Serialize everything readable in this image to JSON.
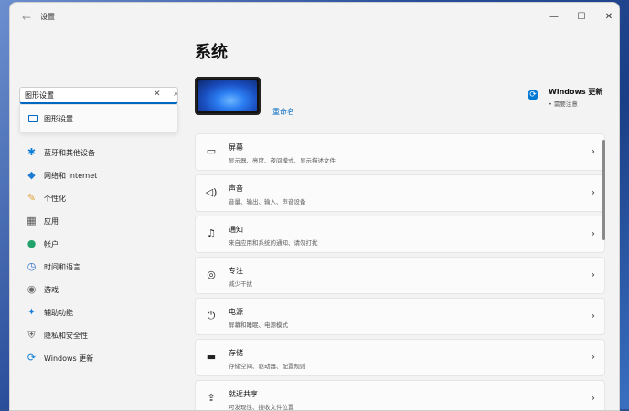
{
  "window": {
    "title": "设置",
    "back_glyph": "←",
    "min_glyph": "—",
    "max_glyph": "☐",
    "close_glyph": "✕"
  },
  "search": {
    "value": "图形设置",
    "clear_glyph": "✕",
    "search_glyph": "⌕",
    "suggestions": [
      {
        "label": "图形设置",
        "icon": "monitor-icon"
      }
    ]
  },
  "nav": {
    "items": [
      {
        "label": "蓝牙和其他设备",
        "icon": "bluetooth-icon",
        "glyph": "✱",
        "color": "#0a7ed6"
      },
      {
        "label": "网络和 Internet",
        "icon": "wifi-icon",
        "glyph": "◆",
        "color": "#1f7cd1"
      },
      {
        "label": "个性化",
        "icon": "brush-icon",
        "glyph": "✎",
        "color": "#e09b2d"
      },
      {
        "label": "应用",
        "icon": "apps-icon",
        "glyph": "▦",
        "color": "#555555"
      },
      {
        "label": "帐户",
        "icon": "account-icon",
        "glyph": "●",
        "color": "#22a36b"
      },
      {
        "label": "时间和语言",
        "icon": "clock-globe-icon",
        "glyph": "◷",
        "color": "#2a6fc7"
      },
      {
        "label": "游戏",
        "icon": "gamepad-icon",
        "glyph": "◉",
        "color": "#6b6b6b"
      },
      {
        "label": "辅助功能",
        "icon": "accessibility-icon",
        "glyph": "✦",
        "color": "#1b7dd6"
      },
      {
        "label": "隐私和安全性",
        "icon": "shield-icon",
        "glyph": "⛨",
        "color": "#6d6d6d"
      },
      {
        "label": "Windows 更新",
        "icon": "windows-update-icon",
        "glyph": "⟳",
        "color": "#0a7ed6"
      }
    ]
  },
  "main": {
    "page_title": "系统",
    "rename_label": "重命名",
    "windows_update": {
      "title": "Windows 更新",
      "subtitle": "• 需要注意"
    },
    "cards": [
      {
        "title": "屏幕",
        "desc": "显示器、亮度、夜间模式、显示描述文件",
        "icon": "display-icon",
        "glyph": "▭"
      },
      {
        "title": "声音",
        "desc": "音量、输出、输入、声音设备",
        "icon": "speaker-icon",
        "glyph": "◁)"
      },
      {
        "title": "通知",
        "desc": "来自应用和系统的通知、请勿打扰",
        "icon": "bell-icon",
        "glyph": "♫"
      },
      {
        "title": "专注",
        "desc": "减少干扰",
        "icon": "focus-icon",
        "glyph": "◎"
      },
      {
        "title": "电源",
        "desc": "屏幕和睡眠、电源模式",
        "icon": "power-icon",
        "glyph": "⏻"
      },
      {
        "title": "存储",
        "desc": "存储空间、驱动器、配置规则",
        "icon": "storage-icon",
        "glyph": "▬"
      },
      {
        "title": "就近共享",
        "desc": "可发现性、接收文件位置",
        "icon": "share-icon",
        "glyph": "⇪"
      }
    ],
    "chevron": "›"
  }
}
